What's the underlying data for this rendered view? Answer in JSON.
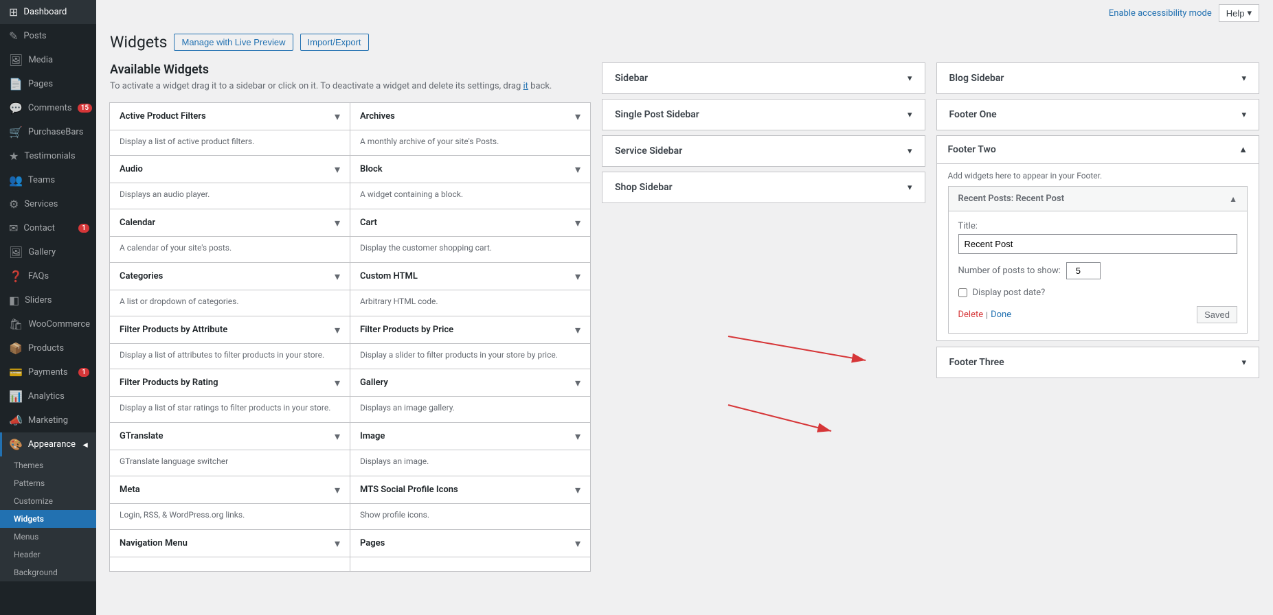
{
  "topbar": {
    "accessibility_link": "Enable accessibility mode",
    "help_label": "Help",
    "help_chevron": "▾"
  },
  "page": {
    "title": "Widgets",
    "manage_btn": "Manage with Live Preview",
    "import_btn": "Import/Export"
  },
  "available_widgets": {
    "title": "Available Widgets",
    "description_start": "To activate a widget drag it to a sidebar or click on it. To deactivate a widget and delete its settings, drag ",
    "description_link": "it",
    "description_end": " back."
  },
  "sidebar": {
    "items": [
      {
        "id": "dashboard",
        "label": "Dashboard",
        "icon": "⊞"
      },
      {
        "id": "posts",
        "label": "Posts",
        "icon": "✎"
      },
      {
        "id": "media",
        "label": "Media",
        "icon": "🖼"
      },
      {
        "id": "pages",
        "label": "Pages",
        "icon": "📄"
      },
      {
        "id": "comments",
        "label": "Comments",
        "icon": "💬",
        "badge": "15"
      },
      {
        "id": "purchasebars",
        "label": "PurchaseBars",
        "icon": "🛒"
      },
      {
        "id": "testimonials",
        "label": "Testimonials",
        "icon": "★"
      },
      {
        "id": "teams",
        "label": "Teams",
        "icon": "👥"
      },
      {
        "id": "services",
        "label": "Services",
        "icon": "⚙"
      },
      {
        "id": "contact",
        "label": "Contact",
        "icon": "✉",
        "badge": "1"
      },
      {
        "id": "gallery",
        "label": "Gallery",
        "icon": "🖼"
      },
      {
        "id": "faqs",
        "label": "FAQs",
        "icon": "?"
      },
      {
        "id": "sliders",
        "label": "Sliders",
        "icon": "◧"
      },
      {
        "id": "woocommerce",
        "label": "WooCommerce",
        "icon": "🛍"
      },
      {
        "id": "products",
        "label": "Products",
        "icon": "📦"
      },
      {
        "id": "payments",
        "label": "Payments",
        "icon": "💳",
        "badge": "1"
      },
      {
        "id": "analytics",
        "label": "Analytics",
        "icon": "📊"
      },
      {
        "id": "marketing",
        "label": "Marketing",
        "icon": "📣"
      },
      {
        "id": "appearance",
        "label": "Appearance",
        "icon": "🎨",
        "active_parent": true
      },
      {
        "id": "themes",
        "label": "Themes",
        "icon": "",
        "sub": true
      },
      {
        "id": "patterns",
        "label": "Patterns",
        "icon": "",
        "sub": true
      },
      {
        "id": "customize",
        "label": "Customize",
        "icon": "",
        "sub": true
      },
      {
        "id": "widgets",
        "label": "Widgets",
        "icon": "",
        "sub": true,
        "active": true
      },
      {
        "id": "menus",
        "label": "Menus",
        "icon": "",
        "sub": true
      },
      {
        "id": "header",
        "label": "Header",
        "icon": "",
        "sub": true
      },
      {
        "id": "background",
        "label": "Background",
        "icon": "",
        "sub": true
      }
    ]
  },
  "widgets": [
    {
      "name": "Active Product Filters",
      "desc": "Display a list of active product filters."
    },
    {
      "name": "Archives",
      "desc": "A monthly archive of your site's Posts."
    },
    {
      "name": "Audio",
      "desc": "Displays an audio player."
    },
    {
      "name": "Block",
      "desc": "A widget containing a block."
    },
    {
      "name": "Calendar",
      "desc": "A calendar of your site's posts."
    },
    {
      "name": "Cart",
      "desc": "Display the customer shopping cart."
    },
    {
      "name": "Categories",
      "desc": "A list or dropdown of categories."
    },
    {
      "name": "Custom HTML",
      "desc": "Arbitrary HTML code."
    },
    {
      "name": "Filter Products by Attribute",
      "desc": "Display a list of attributes to filter products in your store."
    },
    {
      "name": "Filter Products by Price",
      "desc": "Display a slider to filter products in your store by price."
    },
    {
      "name": "Filter Products by Rating",
      "desc": "Display a list of star ratings to filter products in your store."
    },
    {
      "name": "Gallery",
      "desc": "Displays an image gallery."
    },
    {
      "name": "GTranslate",
      "desc": "GTranslate language switcher"
    },
    {
      "name": "Image",
      "desc": "Displays an image."
    },
    {
      "name": "Meta",
      "desc": "Login, RSS, & WordPress.org links."
    },
    {
      "name": "MTS Social Profile Icons",
      "desc": "Show profile icons."
    },
    {
      "name": "Navigation Menu",
      "desc": ""
    },
    {
      "name": "Pages",
      "desc": ""
    }
  ],
  "left_sidebars": [
    {
      "name": "Sidebar",
      "chevron": "▾"
    },
    {
      "name": "Single Post Sidebar",
      "chevron": "▾"
    },
    {
      "name": "Service Sidebar",
      "chevron": "▾"
    },
    {
      "name": "Shop Sidebar",
      "chevron": "▾"
    }
  ],
  "right_col1": [
    {
      "name": "Blog Sidebar",
      "chevron": "▾"
    },
    {
      "name": "Footer One",
      "chevron": "▾"
    }
  ],
  "footer_two": {
    "title": "Footer Two",
    "chevron": "▲",
    "desc": "Add widgets here to appear in your Footer.",
    "widget": {
      "title": "Recent Posts: Recent Post",
      "chevron": "▲",
      "fields": {
        "title_label": "Title:",
        "title_value": "Recent Post",
        "posts_label": "Number of posts to show:",
        "posts_value": "5",
        "date_label": "Display post date?"
      },
      "actions": {
        "delete": "Delete",
        "sep": "|",
        "done": "Done",
        "saved": "Saved"
      }
    }
  },
  "right_col2": [
    {
      "name": "Footer Three",
      "chevron": "▾"
    }
  ]
}
